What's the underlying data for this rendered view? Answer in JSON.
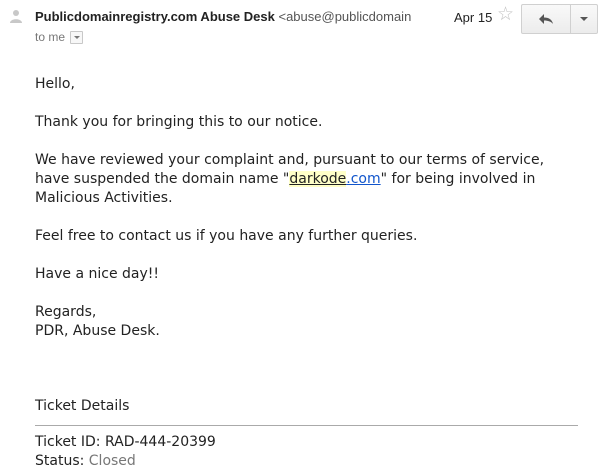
{
  "header": {
    "sender_name": "Publicdomainregistry.com Abuse Desk",
    "sender_email": "<abuse@publicdomain",
    "to_label": "to me",
    "date": "Apr 15",
    "star_icon": "star-icon",
    "reply_icon": "reply-icon",
    "more_icon": "chevron-down-icon"
  },
  "message": {
    "greeting": "Hello,",
    "thanks": "Thank you for bringing this to our notice.",
    "review_part1": "We have reviewed your complaint and, pursuant to our terms of service, have suspended the domain name \"",
    "domain_highlight": "darkode",
    "domain_link": ".com",
    "review_part2": "\" for being involved in Malicious Activities.",
    "contact": "Feel free to contact us if you have any further queries.",
    "nice_day": "Have a nice day!!",
    "regards": "Regards,",
    "signature": "PDR, Abuse Desk."
  },
  "ticket": {
    "title": "Ticket Details",
    "id_label": "Ticket ID: ",
    "id_value": "RAD-444-20399",
    "status_label": "Status: ",
    "status_value": "Closed"
  },
  "colors": {
    "link": "#1155cc",
    "highlight": "#ffffc8",
    "muted": "#777777"
  }
}
